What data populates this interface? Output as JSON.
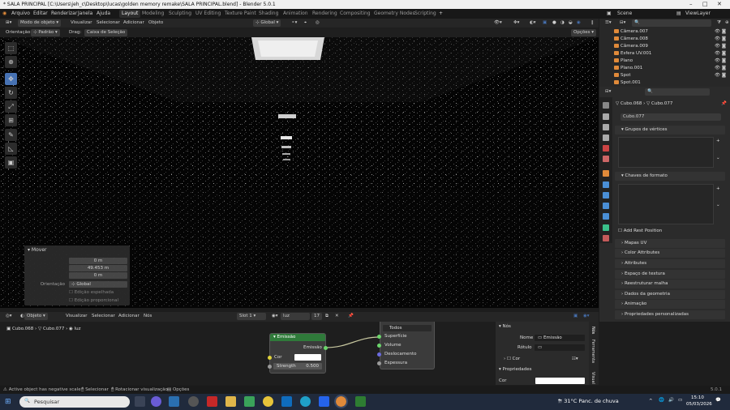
{
  "window": {
    "title": "* SALA PRINCIPAL [C:\\Users\\jeh_c\\Desktop\\lucas\\golden memory remake\\SALA PRINCIPAL.blend] - Blender 5.0.1"
  },
  "menu": [
    "Arquivo",
    "Editar",
    "Renderizar",
    "Janela",
    "Ajuda"
  ],
  "workspaces": [
    "Layout",
    "Modeling",
    "Sculpting",
    "UV Editing",
    "Texture Paint",
    "Shading",
    "Animation",
    "Rendering",
    "Compositing",
    "Geometry Nodes",
    "Scripting"
  ],
  "top_right": {
    "scene": "Scene",
    "view_layer": "ViewLayer"
  },
  "viewport_header": {
    "mode": "Modo de objeto",
    "menus": [
      "Visualizar",
      "Selecionar",
      "Adicionar",
      "Objeto"
    ],
    "transform": "Global"
  },
  "viewport_header2": {
    "orientation_label": "Orientação:",
    "orientation_value": "Padrão",
    "drag_label": "Drag:",
    "drag_value": "Caixa de Seleção",
    "options": "Opções"
  },
  "mover_panel": {
    "title": "Mover",
    "fields": [
      {
        "label": "Mover X",
        "value": "0 m"
      },
      {
        "label": "Y",
        "value": "49.453 m"
      },
      {
        "label": "Z",
        "value": "0 m"
      }
    ],
    "orientation_label": "Orientação",
    "orientation_value": "Global",
    "check1": "Edição espelhada",
    "check2": "Edição proporcional"
  },
  "outliner": {
    "search_placeholder": "",
    "items": [
      "Câmera.007",
      "Câmera.008",
      "Câmera.009",
      "Esfera UV.001",
      "Plano",
      "Plano.001",
      "Spot",
      "Spot.001"
    ]
  },
  "properties": {
    "search_placeholder": "",
    "breadcrumb_object": "Cubo.068",
    "breadcrumb_data": "Cubo.077",
    "mesh_name": "Cubo.077",
    "sections_open": [
      "Grupos de vértices",
      "Chaves de formato"
    ],
    "add_rest_position": "Add Rest Position",
    "sections_closed": [
      "Mapas UV",
      "Color Attributes",
      "Attributes",
      "Espaço de textura",
      "Reestruturar malha",
      "Dados da geometria",
      "Animação",
      "Propriedades personalizadas"
    ]
  },
  "node_header": {
    "editor": "Objeto",
    "menus": [
      "Visualizar",
      "Selecionar",
      "Adicionar",
      "Nós"
    ],
    "slot": "Slot 1",
    "material": "luz",
    "users": "17",
    "breadcrumb": [
      "Cubo.068",
      "Cubo.077",
      "luz"
    ]
  },
  "nodes": {
    "emission": {
      "title": "Emissão",
      "output": "Emissão",
      "color_label": "Cor",
      "strength_label": "Strength",
      "strength_value": "0.500"
    },
    "output": {
      "target": "Todos",
      "inputs": [
        "Superfície",
        "Volume",
        "Deslocamento",
        "Espessura"
      ]
    }
  },
  "node_props": {
    "section": "Nós",
    "name_label": "Nome",
    "name_value": "Emissão",
    "label_label": "Rótulo",
    "color_label": "Cor",
    "props_section": "Propriedades",
    "props_color_label": "Cor",
    "side_tabs": [
      "Nós",
      "Ferramenta",
      "Visual"
    ]
  },
  "statusbar": {
    "msg": "Active object has negative scale",
    "select": "Selecionar",
    "rotate": "Rotacionar visualização",
    "options": "Opções",
    "version": "5.0.1"
  },
  "taskbar": {
    "search": "Pesquisar",
    "weather": "31°C  Panc. de chuva",
    "time": "15:10",
    "date": "05/03/2026"
  },
  "colors": {
    "accent": "#4772b3",
    "emission_header": "#2f7a3a",
    "bg": "#1d1d1d"
  }
}
